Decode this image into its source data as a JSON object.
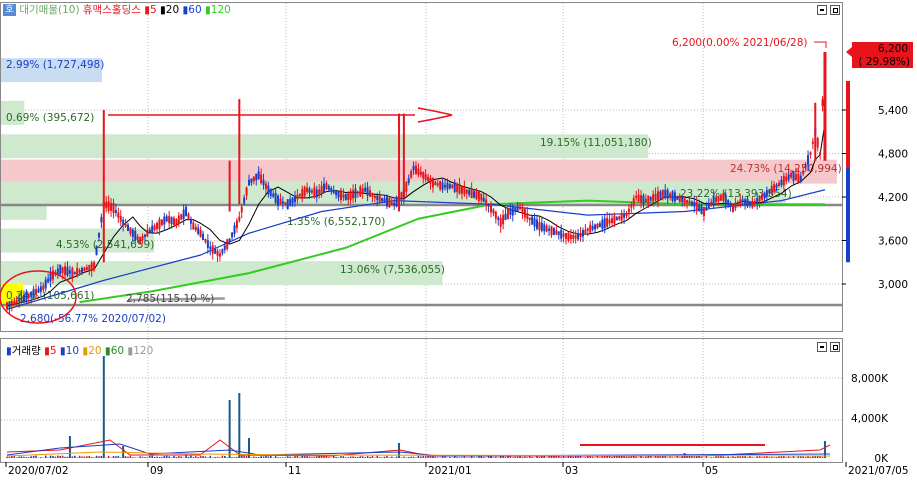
{
  "panel": {
    "top_icon": "호",
    "legend_prefix": "대기매물(10)",
    "name": "휴맥스홀딩스",
    "ma5": "5",
    "ma20": "20",
    "ma60": "60",
    "ma120": "120",
    "vol_label": "거래량",
    "vma5": "5",
    "vma10": "10",
    "vma20": "20",
    "vma60": "60",
    "vma120": "120"
  },
  "colors": {
    "up": "#e8141b",
    "down": "#1a3fc8",
    "ma5": "#000000",
    "ma20": "#1a3fc8",
    "ma60": "#33cc22",
    "ma120": "#999999",
    "profile_green": "#cfe9cf",
    "profile_red": "#f5c8cc",
    "profile_blue": "#c8dcf2",
    "profile_yellow": "#ffff00"
  },
  "chart_data": {
    "type": "candlestick",
    "ylim": [
      2500,
      6500
    ],
    "y_ticks": [
      "6,200",
      "5,400",
      "4,800",
      "4,200",
      "3,600",
      "3,000"
    ],
    "x_ticks": [
      "2020/07/02",
      "09",
      "11",
      "2021/01",
      "03",
      "05",
      "2021/07/05"
    ],
    "volume_ticks": [
      "8,000K",
      "4,000K",
      "0K"
    ],
    "last_price_tag": {
      "price": "6,200",
      "pct": "( 29.98%)"
    },
    "annotations": {
      "high": "6,200(0.00% 2021/06/28)",
      "low": "2,680(-56.77% 2020/07/02)",
      "p2785": "2,785(115.10 %)"
    },
    "volume_profile": [
      {
        "label": "2.99% (1,727,498)"
      },
      {
        "label": "0.69% (395,672)"
      },
      {
        "label": "19.15% (11,051,180)"
      },
      {
        "label": "24.73% (14,250,994)"
      },
      {
        "label": "23.22% (13,393,354)"
      },
      {
        "label": "1.35% (6,552,170)"
      },
      {
        "label": "4.53% (2,541,659)"
      },
      {
        "label": "13.06% (7,536,055)"
      },
      {
        "label": "0.24% (105,661)"
      }
    ],
    "volume_profile_price": [
      {
        "price": 5950,
        "color": "blue"
      },
      {
        "price": 5360,
        "color": "green"
      },
      {
        "price": 4900,
        "color": "green"
      },
      {
        "price": 4550,
        "color": "red"
      },
      {
        "price": 4250,
        "color": "green"
      },
      {
        "price": 4050,
        "color": "green"
      },
      {
        "price": 3600,
        "color": "green"
      },
      {
        "price": 3150,
        "color": "green"
      },
      {
        "price": 2850,
        "color": "yellow"
      }
    ],
    "volume_profile_share": [
      2.99,
      0.69,
      19.15,
      24.73,
      23.22,
      1.35,
      4.53,
      13.06,
      0.24
    ],
    "close_path": [
      [
        0,
        2700
      ],
      [
        10,
        2850
      ],
      [
        15,
        2950
      ],
      [
        18,
        3100
      ],
      [
        22,
        3200
      ],
      [
        28,
        3150
      ],
      [
        32,
        3200
      ],
      [
        36,
        3250
      ],
      [
        40,
        4100
      ],
      [
        44,
        4050
      ],
      [
        48,
        3850
      ],
      [
        52,
        3700
      ],
      [
        55,
        3600
      ],
      [
        58,
        3700
      ],
      [
        62,
        3800
      ],
      [
        66,
        3900
      ],
      [
        70,
        3850
      ],
      [
        74,
        4000
      ],
      [
        77,
        3800
      ],
      [
        80,
        3700
      ],
      [
        84,
        3500
      ],
      [
        88,
        3400
      ],
      [
        92,
        3600
      ],
      [
        96,
        3900
      ],
      [
        100,
        4400
      ],
      [
        104,
        4500
      ],
      [
        108,
        4300
      ],
      [
        112,
        4150
      ],
      [
        116,
        4100
      ],
      [
        120,
        4200
      ],
      [
        124,
        4300
      ],
      [
        128,
        4250
      ],
      [
        132,
        4350
      ],
      [
        136,
        4250
      ],
      [
        140,
        4200
      ],
      [
        144,
        4250
      ],
      [
        148,
        4300
      ],
      [
        152,
        4200
      ],
      [
        156,
        4150
      ],
      [
        160,
        4100
      ],
      [
        164,
        4250
      ],
      [
        168,
        4600
      ],
      [
        172,
        4500
      ],
      [
        176,
        4400
      ],
      [
        180,
        4350
      ],
      [
        184,
        4350
      ],
      [
        188,
        4300
      ],
      [
        192,
        4250
      ],
      [
        196,
        4200
      ],
      [
        200,
        4050
      ],
      [
        204,
        3850
      ],
      [
        208,
        4000
      ],
      [
        212,
        4050
      ],
      [
        216,
        3900
      ],
      [
        220,
        3800
      ],
      [
        224,
        3750
      ],
      [
        228,
        3700
      ],
      [
        232,
        3650
      ],
      [
        236,
        3650
      ],
      [
        240,
        3750
      ],
      [
        244,
        3800
      ],
      [
        248,
        3850
      ],
      [
        252,
        3900
      ],
      [
        256,
        3950
      ],
      [
        260,
        4200
      ],
      [
        264,
        4150
      ],
      [
        268,
        4200
      ],
      [
        272,
        4250
      ],
      [
        276,
        4200
      ],
      [
        280,
        4150
      ],
      [
        284,
        4100
      ],
      [
        288,
        4000
      ],
      [
        292,
        4150
      ],
      [
        296,
        4200
      ],
      [
        300,
        4050
      ],
      [
        304,
        4150
      ],
      [
        308,
        4100
      ],
      [
        312,
        4200
      ],
      [
        316,
        4300
      ],
      [
        320,
        4400
      ],
      [
        324,
        4500
      ],
      [
        328,
        4450
      ],
      [
        332,
        4800
      ],
      [
        334,
        5100
      ],
      [
        336,
        4800
      ],
      [
        338,
        6200
      ]
    ],
    "volume_spikes": [
      [
        40,
        10200
      ],
      [
        96,
        6500
      ],
      [
        92,
        5800
      ],
      [
        100,
        2000
      ],
      [
        162,
        1500
      ],
      [
        26,
        2200
      ],
      [
        48,
        1200
      ],
      [
        200,
        300
      ],
      [
        280,
        500
      ],
      [
        338,
        1700
      ]
    ],
    "ma20_path": [
      [
        0,
        2650
      ],
      [
        40,
        3050
      ],
      [
        80,
        3400
      ],
      [
        100,
        3700
      ],
      [
        130,
        4000
      ],
      [
        160,
        4150
      ],
      [
        200,
        4100
      ],
      [
        240,
        3950
      ],
      [
        280,
        4000
      ],
      [
        320,
        4150
      ],
      [
        338,
        4300
      ]
    ],
    "ma60_path": [
      [
        30,
        2750
      ],
      [
        60,
        2900
      ],
      [
        100,
        3150
      ],
      [
        140,
        3500
      ],
      [
        170,
        3900
      ],
      [
        200,
        4100
      ],
      [
        240,
        4150
      ],
      [
        280,
        4100
      ],
      [
        338,
        4100
      ]
    ],
    "ma120_path": [
      [
        50,
        2780
      ],
      [
        90,
        2800
      ]
    ]
  }
}
